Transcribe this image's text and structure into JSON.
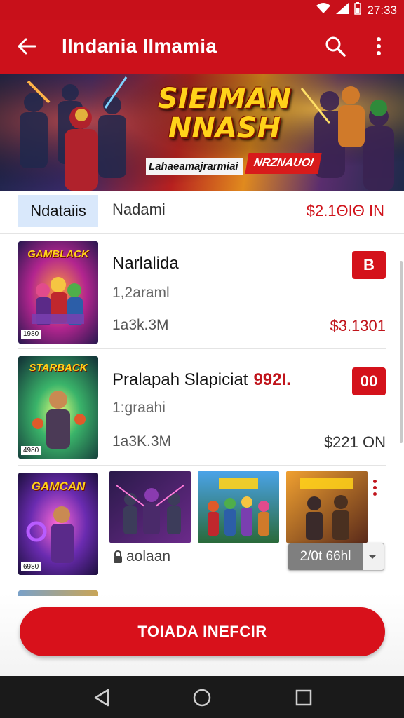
{
  "status_bar": {
    "time": "27:33",
    "icons": [
      "wifi-icon",
      "signal-icon",
      "battery-icon"
    ]
  },
  "app_bar": {
    "title": "Ilndania Ilmamia",
    "icons": [
      "back-arrow-icon",
      "search-icon",
      "more-vertical-icon"
    ]
  },
  "banner": {
    "title": "SIEIMAN\nNNASH",
    "tagline": "Lahaeamajrarmiai",
    "badge": "NRZNAUOI"
  },
  "list_header": {
    "tab": "Ndataiis",
    "label": "Nadami",
    "price": "$2.1ΘΙΘ ΙΝ"
  },
  "items": [
    {
      "title": "Narlalida",
      "title_accent": "",
      "subtitle": "1,2araml",
      "meta": "1a3k.3M",
      "price": "$3.1301",
      "badge": "B",
      "thumb_label": "GAMBLACK",
      "thumb_corner": "1980"
    },
    {
      "title": "Pralapah  Slapiciat",
      "title_accent": "992I.",
      "subtitle": "1:graahi",
      "meta": "1a3K.3M",
      "price": "$221 ΟΝ",
      "badge": "00",
      "thumb_label": "STARBACK",
      "thumb_corner": "4980"
    },
    {
      "thumb_label": "GAMCAN",
      "thumb_corner": "6980",
      "screenshots": [
        "dark-fighters",
        "team-heroes",
        "brawlers"
      ],
      "lock_label": "aolaan",
      "dropdown_value": "2/0t 66hl"
    }
  ],
  "cta": {
    "label": "TOIADA INEFCIR"
  },
  "nav_bar": {
    "icons": [
      "back-triangle-icon",
      "home-circle-icon",
      "recents-square-icon"
    ]
  },
  "colors": {
    "accent": "#cc111b",
    "price": "#c0141b",
    "tab_chip": "#d9e8fb"
  }
}
